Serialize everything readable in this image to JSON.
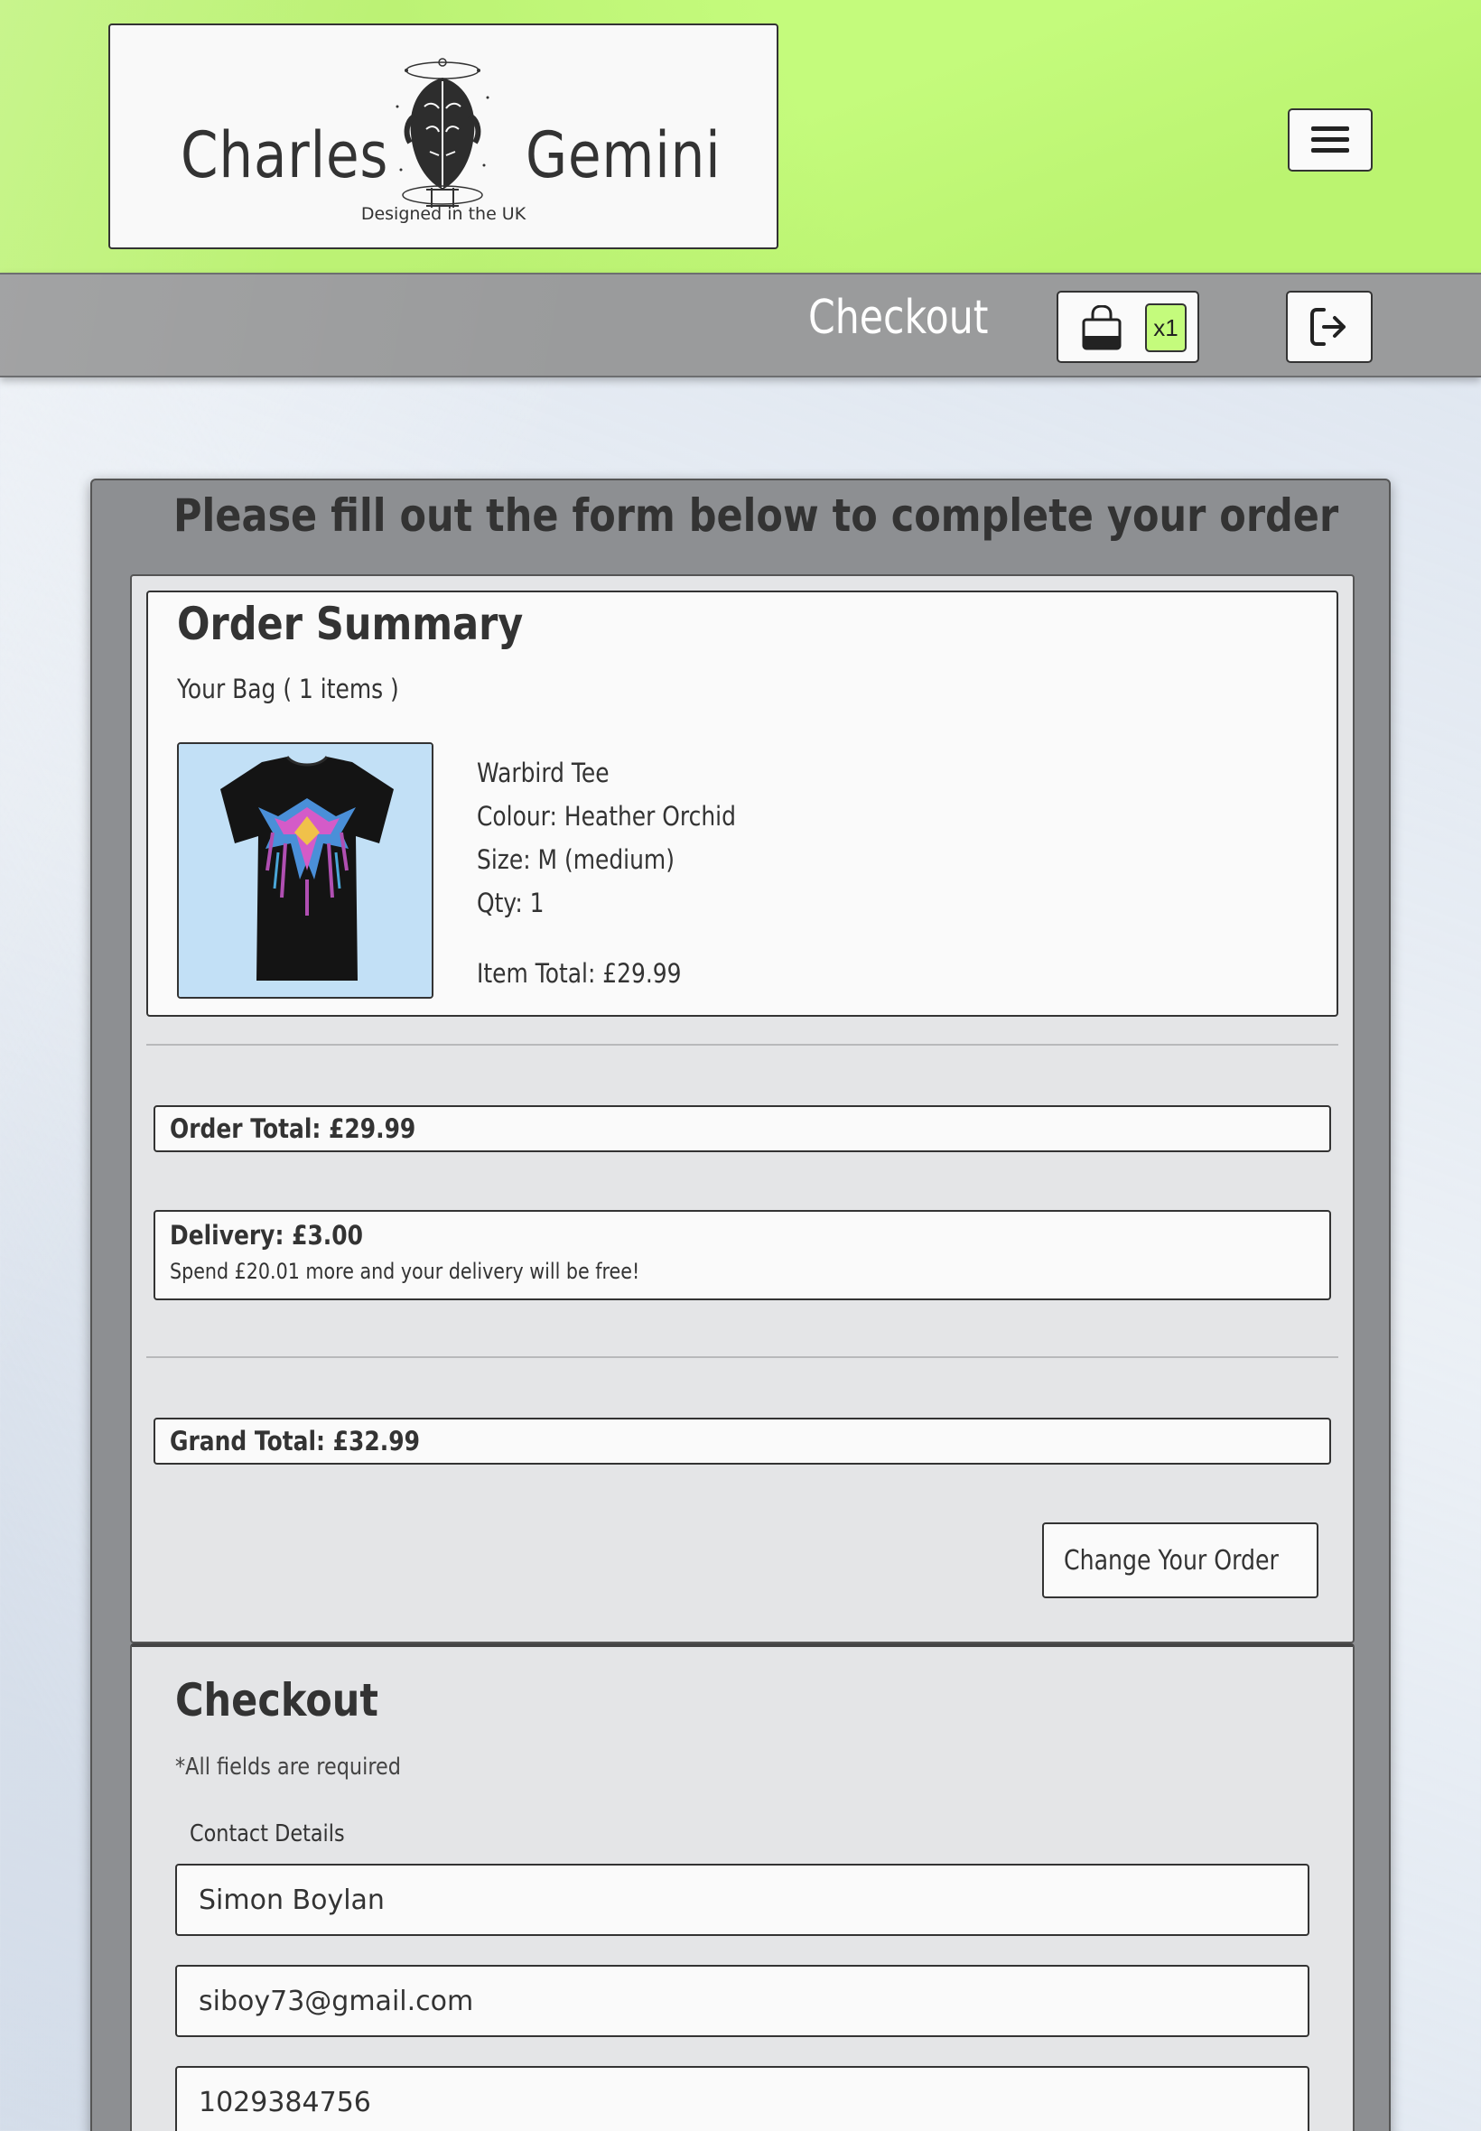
{
  "header": {
    "logo_left": "Charles",
    "logo_right": "Gemini",
    "logo_tagline": "Designed in the UK",
    "menu_icon": "hamburger-menu-icon"
  },
  "subheader": {
    "title": "Checkout",
    "bag_icon": "shopping-bag-icon",
    "bag_count": "x1",
    "logout_icon": "sign-out-icon"
  },
  "main": {
    "heading": "Please fill out the form below to complete your order",
    "summary": {
      "title": "Order Summary",
      "bag_line": "Your Bag ( 1 items )",
      "item": {
        "name": "Warbird Tee",
        "colour": "Colour: Heather Orchid",
        "size": "Size: M (medium)",
        "qty": "Qty: 1",
        "item_total": "Item Total: £29.99"
      },
      "order_total": "Order Total: £29.99",
      "delivery": "Delivery: £3.00",
      "delivery_note": "Spend £20.01 more and your delivery will be free!",
      "grand_total": "Grand Total: £32.99",
      "change_button": "Change Your Order",
      "change_icon": "arrow-left-icon"
    },
    "checkout": {
      "title": "Checkout",
      "required_note": "*All fields are required",
      "contact_legend": "Contact Details",
      "full_name": "Simon Boylan",
      "email": "siboy73@gmail.com",
      "phone": "1029384756"
    }
  },
  "colors": {
    "header_green": "#c4fb7c",
    "subheader_grey": "#9a9b9c",
    "panel_grey": "#8d8f92",
    "card_white": "#fafafa",
    "text_dark": "#333333"
  }
}
